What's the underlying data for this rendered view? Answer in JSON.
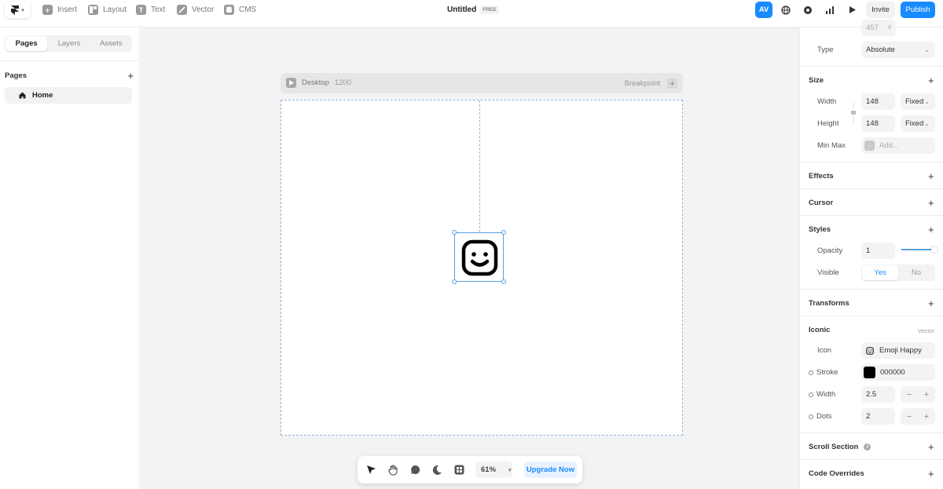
{
  "toolbar": {
    "items": [
      {
        "label": "Insert",
        "icon": "plus-square-icon"
      },
      {
        "label": "Layout",
        "icon": "layout-icon"
      },
      {
        "label": "Text",
        "icon": "text-icon"
      },
      {
        "label": "Vector",
        "icon": "pen-icon"
      },
      {
        "label": "CMS",
        "icon": "database-icon"
      }
    ],
    "doc_title": "Untitled",
    "plan_badge": "FREE",
    "avatar": "AV",
    "invite_label": "Invite",
    "publish_label": "Publish"
  },
  "left_panel": {
    "tabs": [
      "Pages",
      "Layers",
      "Assets"
    ],
    "active_tab": "Pages",
    "section_title": "Pages",
    "pages": [
      "Home"
    ]
  },
  "canvas": {
    "breakpoint_name": "Desktop",
    "breakpoint_width": "1200",
    "breakpoint_label": "Breakpoint",
    "zoom": "61%",
    "upgrade_label": "Upgrade Now"
  },
  "properties": {
    "position_partial": "457",
    "position_unit": "8",
    "type_label": "Type",
    "type_value": "Absolute",
    "size": {
      "title": "Size",
      "width_label": "Width",
      "width_value": "148",
      "width_mode": "Fixed",
      "height_label": "Height",
      "height_value": "148",
      "height_mode": "Fixed",
      "minmax_label": "Min Max",
      "minmax_placeholder": "Add..."
    },
    "effects_title": "Effects",
    "cursor_title": "Cursor",
    "styles": {
      "title": "Styles",
      "opacity_label": "Opacity",
      "opacity_value": "1",
      "opacity_level": 1,
      "visible_label": "Visible",
      "visible_yes": "Yes",
      "visible_no": "No"
    },
    "transforms_title": "Transforms",
    "iconic": {
      "title": "Iconic",
      "subtitle": "Vector",
      "icon_label": "Icon",
      "icon_value": "Emoji Happy",
      "stroke_label": "Stroke",
      "stroke_value": "000000",
      "stroke_color": "#000000",
      "width_label": "Width",
      "width_value": "2.5",
      "dots_label": "Dots",
      "dots_value": "2"
    },
    "scroll_section_title": "Scroll Section",
    "code_overrides_title": "Code Overrides"
  },
  "colors": {
    "accent": "#1a8bff",
    "canvas_bg": "#f3f3f3"
  }
}
